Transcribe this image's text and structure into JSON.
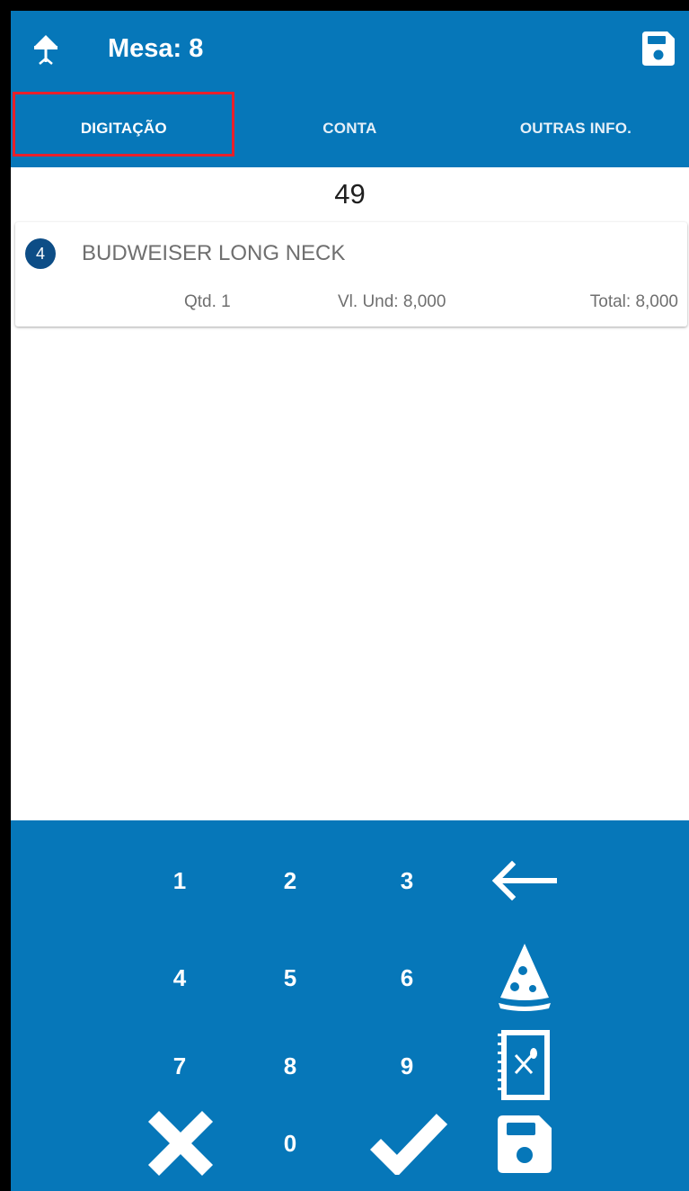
{
  "header": {
    "title": "Mesa: 8"
  },
  "tabs": [
    {
      "label": "DIGITAÇÃO",
      "active": true
    },
    {
      "label": "CONTA",
      "active": false
    },
    {
      "label": "OUTRAS INFO.",
      "active": false
    }
  ],
  "input": {
    "code": "49"
  },
  "items": [
    {
      "number": "4",
      "name": "BUDWEISER LONG NECK",
      "qty": "Qtd. 1",
      "unit_price": "Vl. Und: 8,000",
      "total": "Total: 8,000"
    }
  ],
  "keypad": {
    "keys": [
      "1",
      "2",
      "3",
      "4",
      "5",
      "6",
      "7",
      "8",
      "9",
      "0"
    ],
    "icons": [
      "back-arrow-icon",
      "pizza-icon",
      "menu-book-icon",
      "cancel-icon",
      "confirm-check-icon",
      "save-icon"
    ]
  },
  "colors": {
    "primary": "#0677b9",
    "badge": "#0d4d86",
    "highlight": "#e8202a"
  }
}
